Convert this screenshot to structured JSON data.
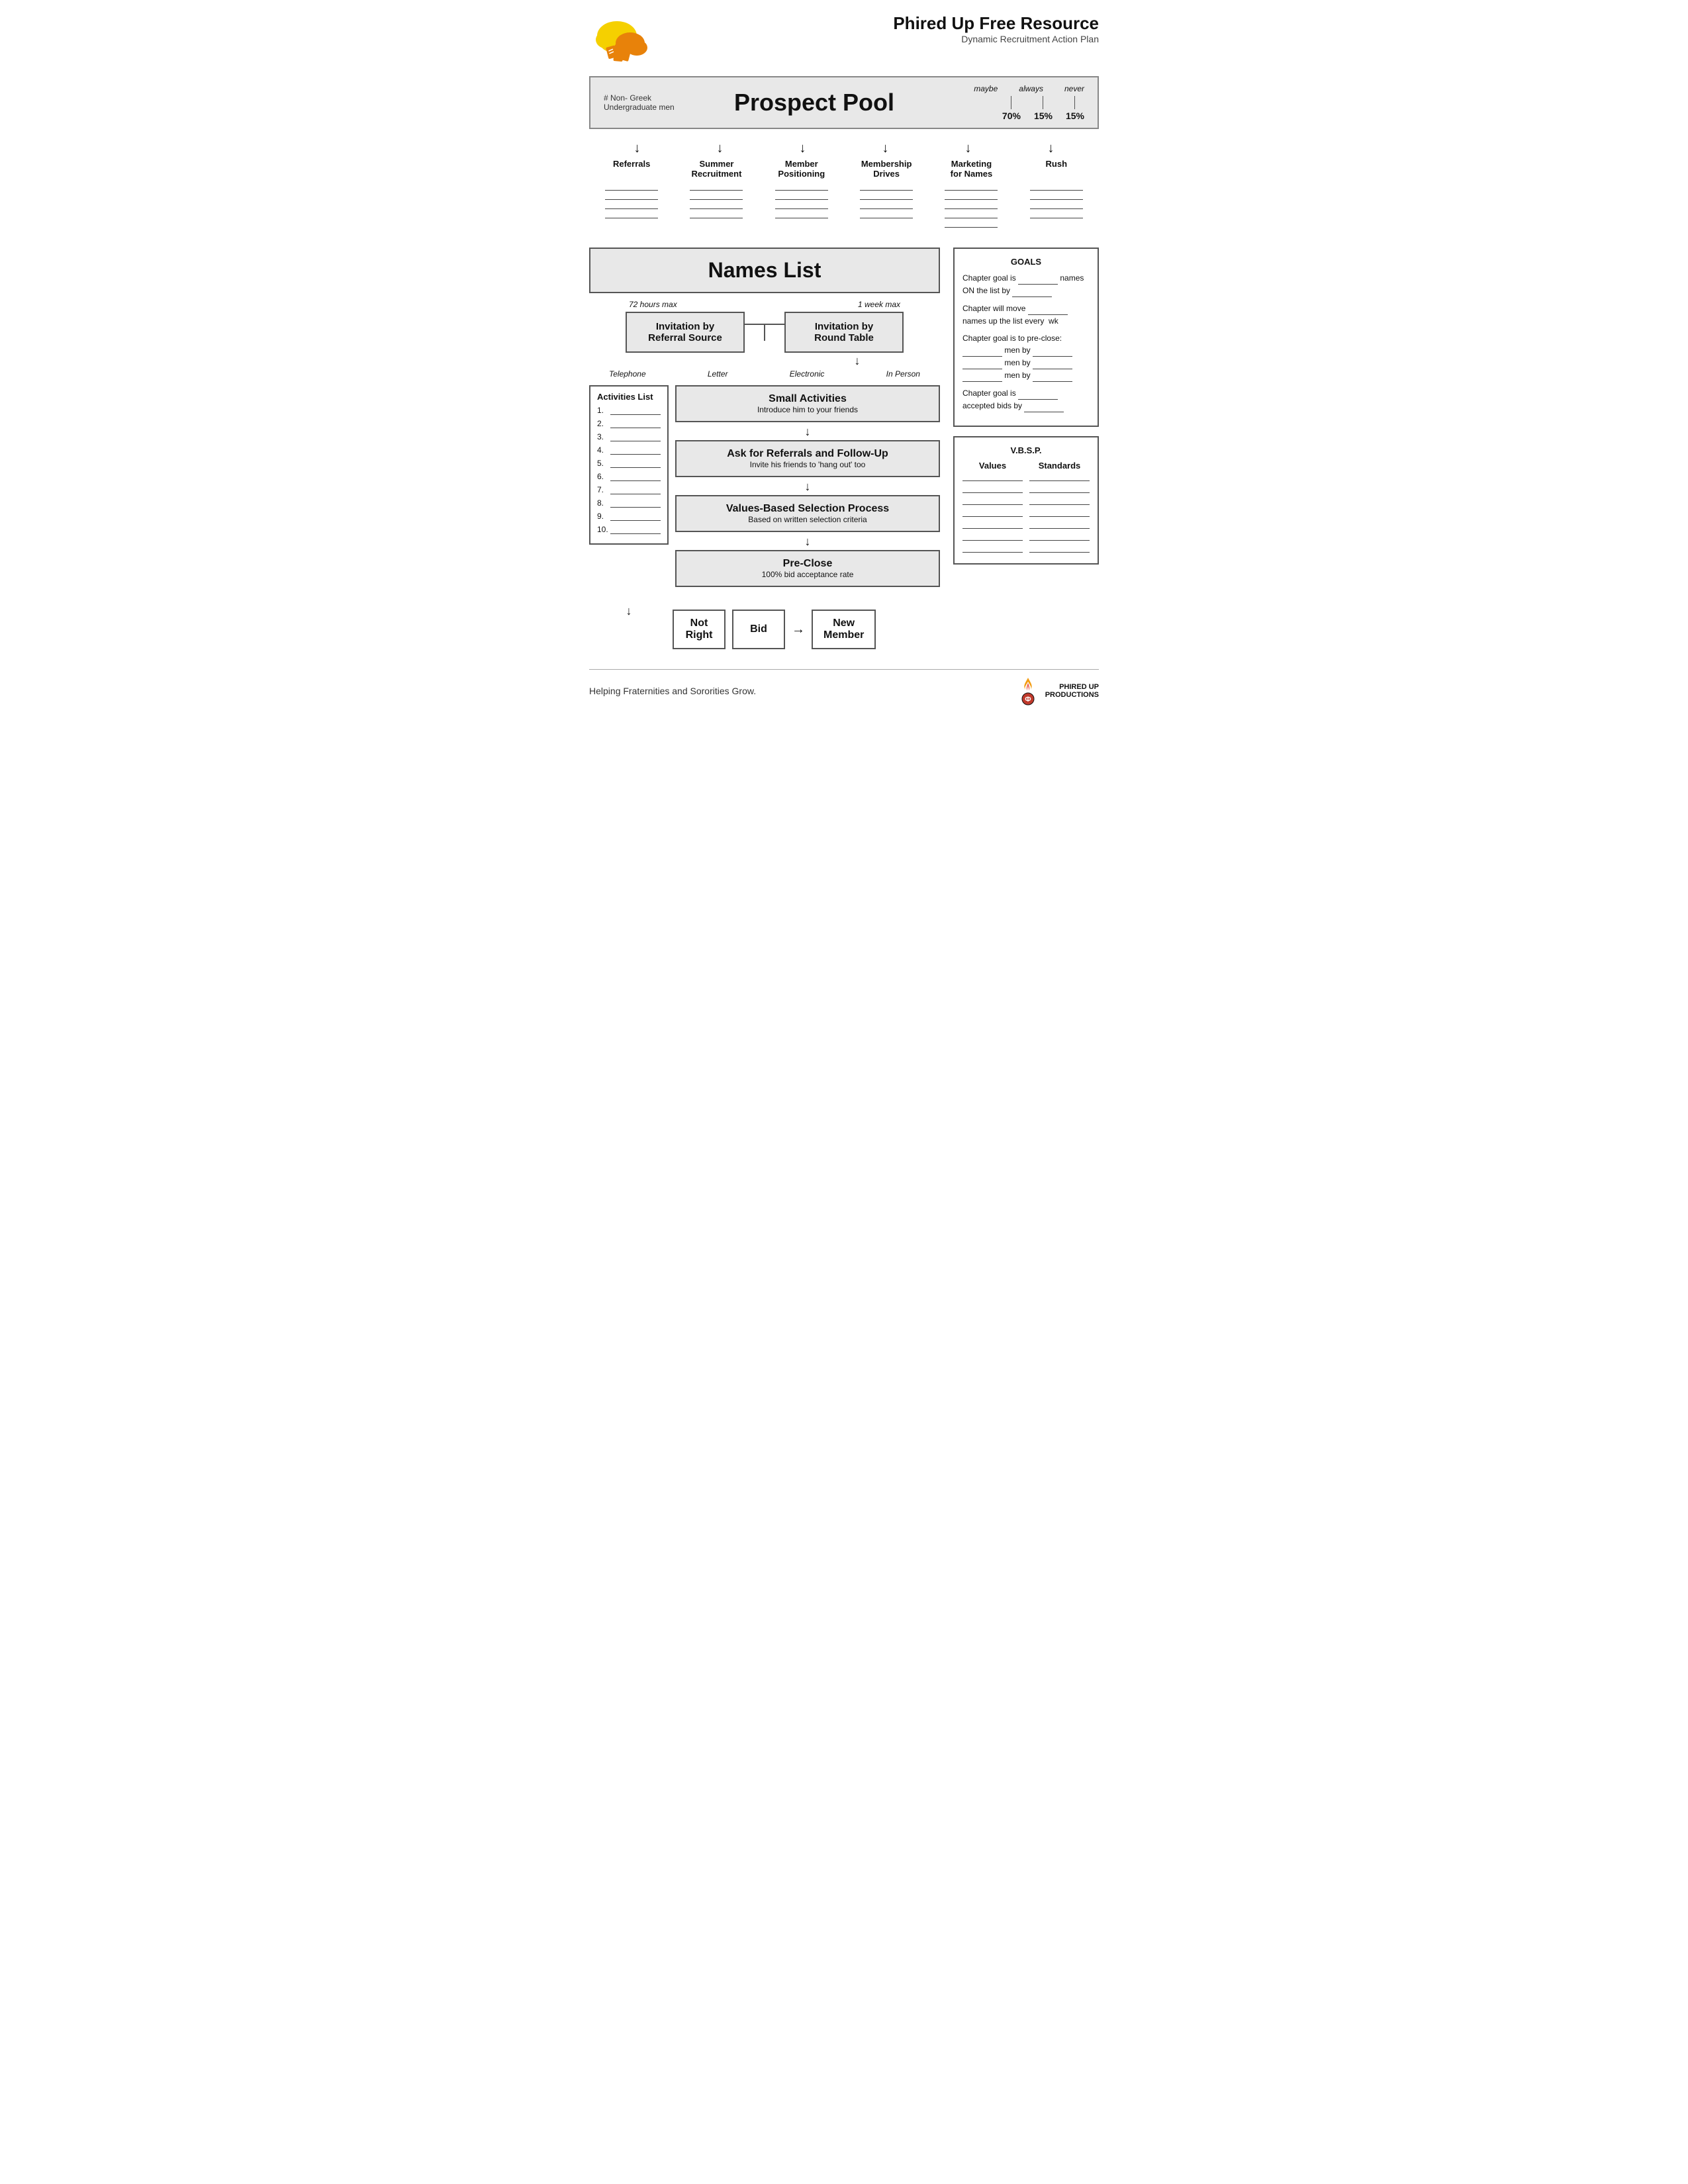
{
  "header": {
    "title": "Phired Up Free Resource",
    "subtitle": "Dynamic Recruitment Action Plan"
  },
  "prospect_pool": {
    "label": "# Non- Greek Undergraduate men",
    "title": "Prospect Pool",
    "percentages": {
      "maybe_label": "maybe",
      "always_label": "always",
      "never_label": "never",
      "maybe_val": "70%",
      "always_val": "15%",
      "never_val": "15%"
    }
  },
  "categories": [
    "Referrals",
    "Summer Recruitment",
    "Member Positioning",
    "Membership Drives",
    "Marketing for Names",
    "Rush"
  ],
  "names_list": {
    "title": "Names List"
  },
  "invitation_timing": {
    "left": "72 hours max",
    "right": "1 week max"
  },
  "invitation_boxes": {
    "left": "Invitation by\nReferral Source",
    "right": "Invitation by\nRound Table"
  },
  "invitation_methods": {
    "telephone": "Telephone",
    "letter": "Letter",
    "electronic": "Electronic",
    "in_person": "In Person"
  },
  "activities_list": {
    "title": "Activities List",
    "items": [
      "1.",
      "2.",
      "3.",
      "4.",
      "5.",
      "6.",
      "7.",
      "8.",
      "9.",
      "10."
    ]
  },
  "flow_boxes": [
    {
      "title": "Small Activities",
      "subtitle": "Introduce him to your friends"
    },
    {
      "title": "Ask for Referrals and Follow-Up",
      "subtitle": "Invite his friends to 'hang out' too"
    },
    {
      "title": "Values-Based Selection Process",
      "subtitle": "Based on written selection criteria"
    },
    {
      "title": "Pre-Close",
      "subtitle": "100% bid acceptance rate"
    }
  ],
  "bottom_row": {
    "not_right": "Not\nRight",
    "bid": "Bid",
    "new_member": "New\nMember"
  },
  "goals": {
    "title": "GOALS",
    "lines": [
      "Chapter goal is ______ names ON the list by _______________",
      "Chapter will move ______ names up the list every  wk",
      "Chapter goal is to pre-close: ______ men by ___________ ______ men by __________ ______ men by __________",
      "Chapter goal is ______ accepted bids by _________"
    ]
  },
  "vbsp": {
    "title": "V.B.S.P.",
    "col1": "Values",
    "col2": "Standards",
    "num_lines": 7
  },
  "footer": {
    "text": "Helping Fraternities and Sororities Grow.",
    "logo": "PHIRED UP\nPRODUCTIONS"
  }
}
